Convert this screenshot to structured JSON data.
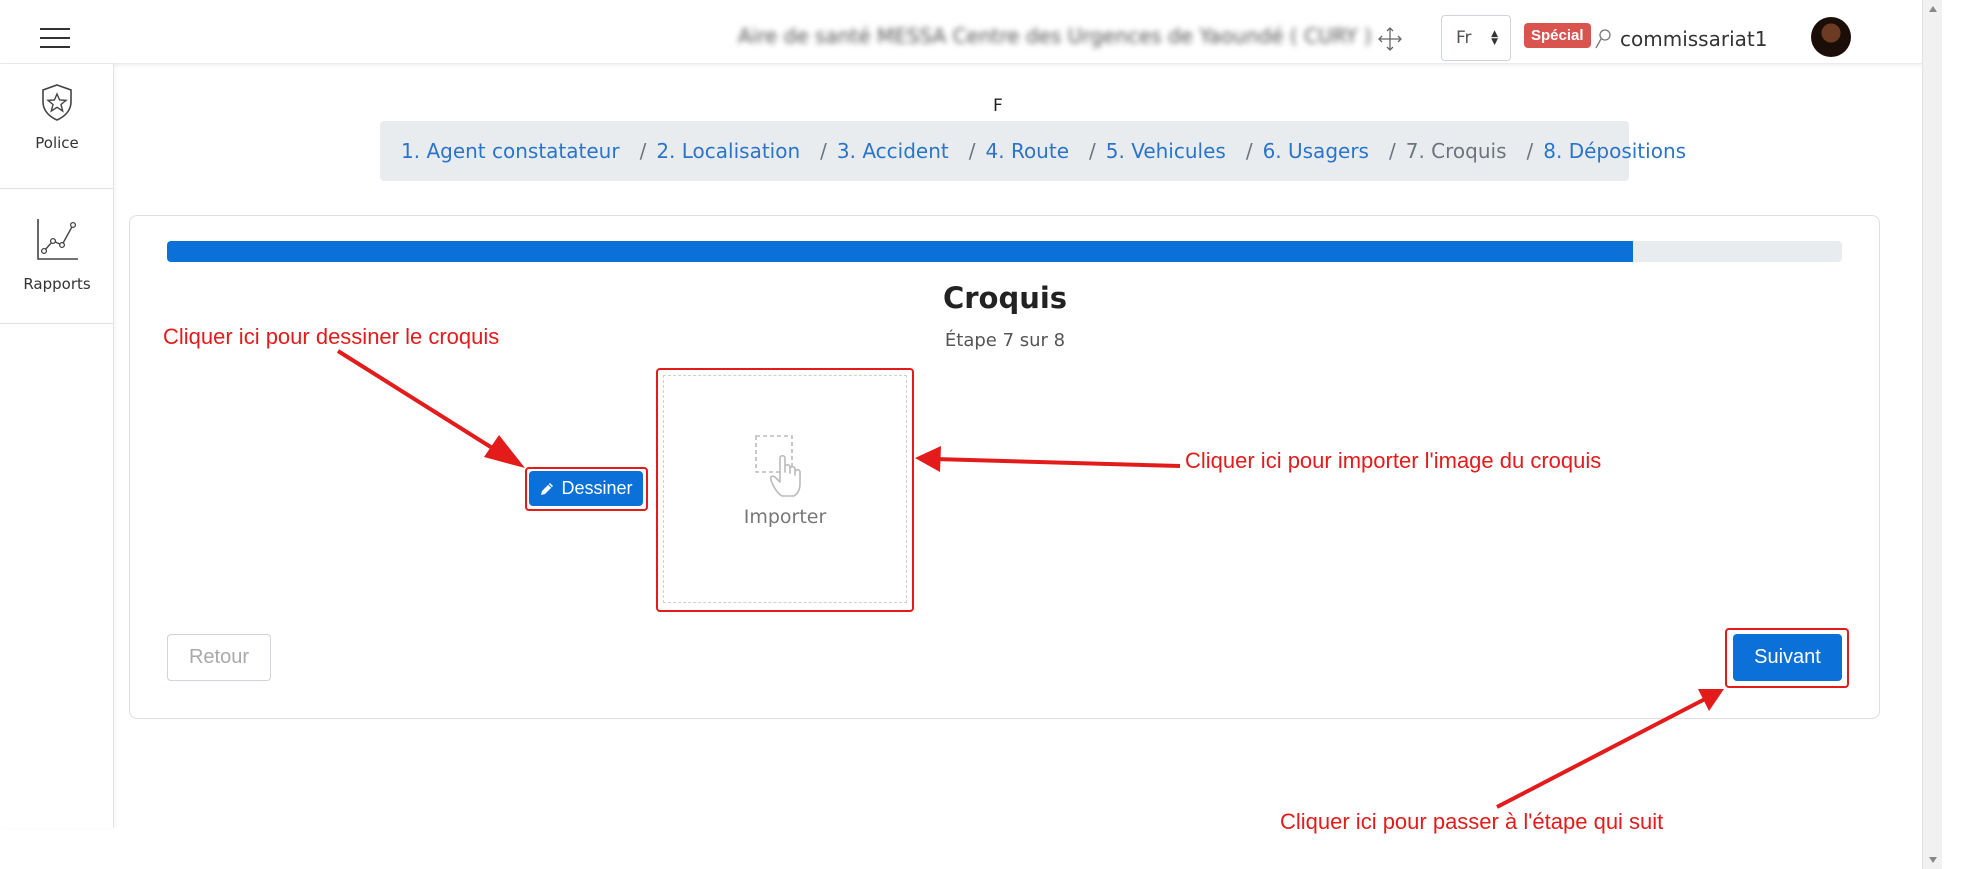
{
  "header": {
    "location_text": "Aire de santé MESSA Centre des Urgences de Yaoundé ( CURY )",
    "language": "Fr",
    "badge": "Spécial",
    "username": "commissariat1"
  },
  "sidebar": {
    "items": [
      {
        "label": "Police",
        "icon": "shield-star-icon"
      },
      {
        "label": "Rapports",
        "icon": "line-chart-icon"
      }
    ]
  },
  "page_letter": "F",
  "breadcrumb": [
    {
      "label": "1. Agent constatateur"
    },
    {
      "label": "2. Localisation"
    },
    {
      "label": "3. Accident"
    },
    {
      "label": "4. Route"
    },
    {
      "label": "5. Vehicules"
    },
    {
      "label": "6. Usagers"
    },
    {
      "label": "7. Croquis",
      "active": true
    },
    {
      "label": "8. Dépositions"
    }
  ],
  "wizard": {
    "progress_fraction": 0.875,
    "title": "Croquis",
    "subtitle": "Étape 7 sur 8",
    "draw_button": "Dessiner",
    "import_label": "Importer",
    "back_button": "Retour",
    "next_button": "Suivant"
  },
  "annotations": {
    "draw": "Cliquer ici pour dessiner le croquis",
    "import": "Cliquer ici pour importer l'image du croquis",
    "next": "Cliquer ici pour passer à l'étape qui suit"
  },
  "colors": {
    "primary": "#0b71d8",
    "annotation_red": "#e31b1b",
    "badge_red": "#d9534f",
    "breadcrumb_bg": "#e9ecef"
  }
}
